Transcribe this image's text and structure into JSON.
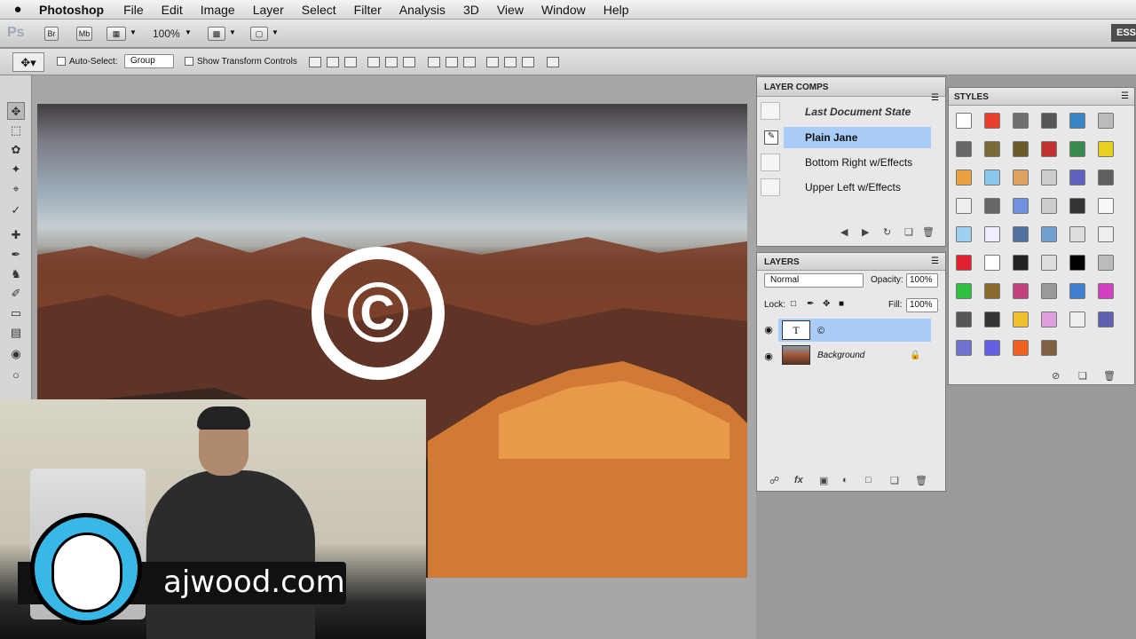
{
  "menubar": {
    "apple": "",
    "app_name": "Photoshop",
    "items": [
      "File",
      "Edit",
      "Image",
      "Layer",
      "Select",
      "Filter",
      "Analysis",
      "3D",
      "View",
      "Window",
      "Help"
    ]
  },
  "appbar": {
    "ps_logo": "Ps",
    "bridge": "Br",
    "minibridge": "Mb",
    "zoom": "100%",
    "essentials": "ESS"
  },
  "options": {
    "auto_select_label": "Auto-Select:",
    "auto_select_value": "Group",
    "show_transform_label": "Show Transform Controls"
  },
  "canvas": {
    "copyright_symbol": "©"
  },
  "video": {
    "brand": "ajwood.com"
  },
  "layer_comps": {
    "title": "LAYER COMPS",
    "items": [
      {
        "label": "Last Document State",
        "selected": false
      },
      {
        "label": "Plain Jane",
        "selected": true
      },
      {
        "label": "Bottom Right w/Effects",
        "selected": false
      },
      {
        "label": "Upper Left w/Effects",
        "selected": false
      }
    ]
  },
  "layers": {
    "title": "LAYERS",
    "blend_mode": "Normal",
    "opacity_label": "Opacity:",
    "opacity_value": "100%",
    "lock_label": "Lock:",
    "fill_label": "Fill:",
    "fill_value": "100%",
    "rows": [
      {
        "thumb": "T",
        "name": "©",
        "selected": true
      },
      {
        "thumb": "",
        "name": "Background",
        "selected": false
      }
    ]
  },
  "styles": {
    "title": "STYLES"
  },
  "colors": {
    "selection_blue": "#a9cdf6",
    "panel_bg": "#e8e8e8",
    "brand_blue": "#37b8e6"
  }
}
